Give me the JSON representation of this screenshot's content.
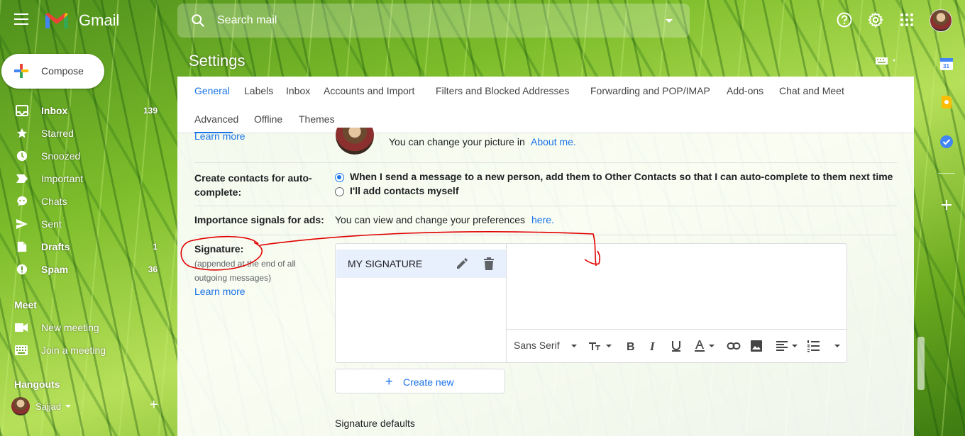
{
  "app": {
    "name": "Gmail"
  },
  "search": {
    "placeholder": "Search mail"
  },
  "compose": {
    "label": "Compose"
  },
  "nav": [
    {
      "label": "Inbox",
      "count": "139",
      "bold": true,
      "icon": "inbox-icon"
    },
    {
      "label": "Starred",
      "count": "",
      "bold": false,
      "icon": "star-icon"
    },
    {
      "label": "Snoozed",
      "count": "",
      "bold": false,
      "icon": "clock-icon"
    },
    {
      "label": "Important",
      "count": "",
      "bold": false,
      "icon": "important-icon"
    },
    {
      "label": "Chats",
      "count": "",
      "bold": false,
      "icon": "chat-icon"
    },
    {
      "label": "Sent",
      "count": "",
      "bold": false,
      "icon": "send-icon"
    },
    {
      "label": "Drafts",
      "count": "1",
      "bold": true,
      "icon": "draft-icon"
    },
    {
      "label": "Spam",
      "count": "36",
      "bold": true,
      "icon": "spam-icon"
    }
  ],
  "meet": {
    "title": "Meet",
    "items": [
      {
        "label": "New meeting",
        "icon": "video-icon"
      },
      {
        "label": "Join a meeting",
        "icon": "keyboard-icon"
      }
    ]
  },
  "hangouts": {
    "title": "Hangouts",
    "user": "Sajjad"
  },
  "settings": {
    "title": "Settings",
    "tabs": [
      "General",
      "Labels",
      "Inbox",
      "Accounts and Import",
      "Filters and Blocked Addresses",
      "Forwarding and POP/IMAP",
      "Add-ons",
      "Chat and Meet",
      "Advanced",
      "Offline",
      "Themes"
    ],
    "active_tab": "General",
    "picture": {
      "learn_more": "Learn more",
      "text": "You can change your picture in",
      "link": "About me."
    },
    "contacts": {
      "label": "Create contacts for auto-complete:",
      "option1": "When I send a message to a new person, add them to Other Contacts so that I can auto-complete to them next time",
      "option2": "I'll add contacts myself",
      "selected": 1
    },
    "ads": {
      "label": "Importance signals for ads:",
      "text": "You can view and change your preferences",
      "link": "here."
    },
    "signature": {
      "label": "Signature:",
      "sub": "(appended at the end of all outgoing messages)",
      "learn_more": "Learn more",
      "item_name": "MY SIGNATURE",
      "font": "Sans Serif",
      "create_new": "Create new",
      "defaults_title": "Signature defaults"
    }
  },
  "colors": {
    "accent": "#1a73e8",
    "annotation": "#e00000"
  }
}
